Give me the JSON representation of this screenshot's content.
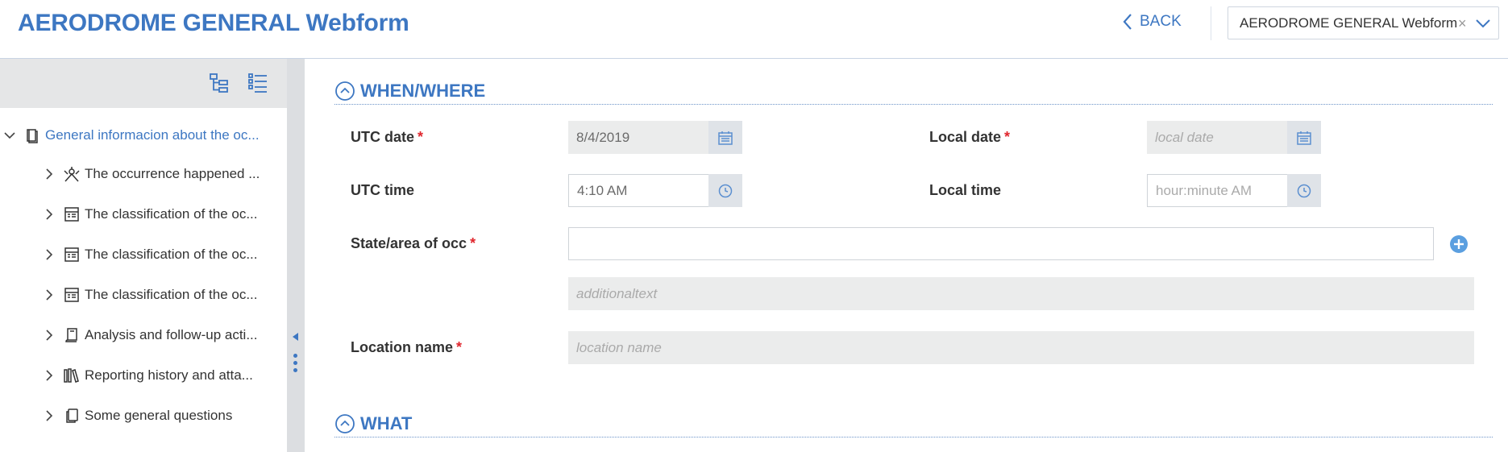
{
  "header": {
    "title": "AERODROME GENERAL Webform",
    "back_label": "BACK",
    "form_select_value": "AERODROME GENERAL Webform"
  },
  "sidebar": {
    "root": {
      "label": "General informacion about the oc...",
      "icon": "book-icon"
    },
    "items": [
      {
        "label": "The occurrence happened ...",
        "icon": "network-person-icon"
      },
      {
        "label": "The classification of the oc...",
        "icon": "form-icon"
      },
      {
        "label": "The classification of the oc...",
        "icon": "form-icon"
      },
      {
        "label": "The classification of the oc...",
        "icon": "form-icon"
      },
      {
        "label": "Analysis and follow-up acti...",
        "icon": "book-open-icon"
      },
      {
        "label": "Reporting history and atta...",
        "icon": "library-icon"
      },
      {
        "label": "Some general questions",
        "icon": "copy-icon"
      }
    ]
  },
  "sections": {
    "when_where": "WHEN/WHERE",
    "what": "WHAT"
  },
  "fields": {
    "utc_date": {
      "label": "UTC date",
      "value": "8/4/2019"
    },
    "local_date": {
      "label": "Local date",
      "placeholder": "local date"
    },
    "utc_time": {
      "label": "UTC time",
      "value": "4:10 AM"
    },
    "local_time": {
      "label": "Local time",
      "placeholder": "hour:minute AM"
    },
    "state_area": {
      "label": "State/area of occ",
      "value": ""
    },
    "additional_text": {
      "placeholder": "additionaltext"
    },
    "location_name": {
      "label": "Location name",
      "placeholder": "location name"
    }
  },
  "colors": {
    "accent": "#3d77c2",
    "required": "#e0262d",
    "input_bg": "#ebecec",
    "toolbar_bg": "#e5e6e7"
  }
}
